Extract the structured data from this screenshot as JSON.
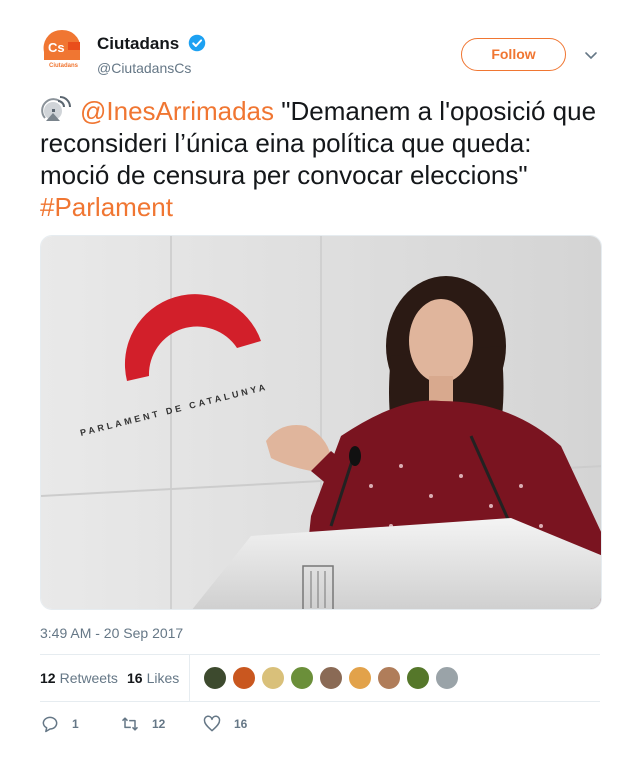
{
  "account": {
    "name": "Ciutadans",
    "handle": "@CiutadansCs",
    "avatar_text": "Cs",
    "avatar_subtext": "Ciutadans"
  },
  "follow_label": "Follow",
  "tweet": {
    "mention": "@InesArrimadas",
    "text": " \"Demanem a l'oposició que reconsideri l’única eina política que queda: moció de censura per convocar eleccions\" ",
    "hashtag": "#Parlament"
  },
  "photo": {
    "sign_text": "PARLAMENT DE CATALUNYA"
  },
  "timestamp": "3:49 AM - 20 Sep 2017",
  "stats": {
    "retweets_count": "12",
    "retweets_label": "Retweets",
    "likes_count": "16",
    "likes_label": "Likes"
  },
  "actions": {
    "replies": "1",
    "retweets": "12",
    "likes": "16"
  },
  "colors": {
    "accent": "#f07632",
    "verified": "#1da1f2",
    "muted": "#657786"
  }
}
